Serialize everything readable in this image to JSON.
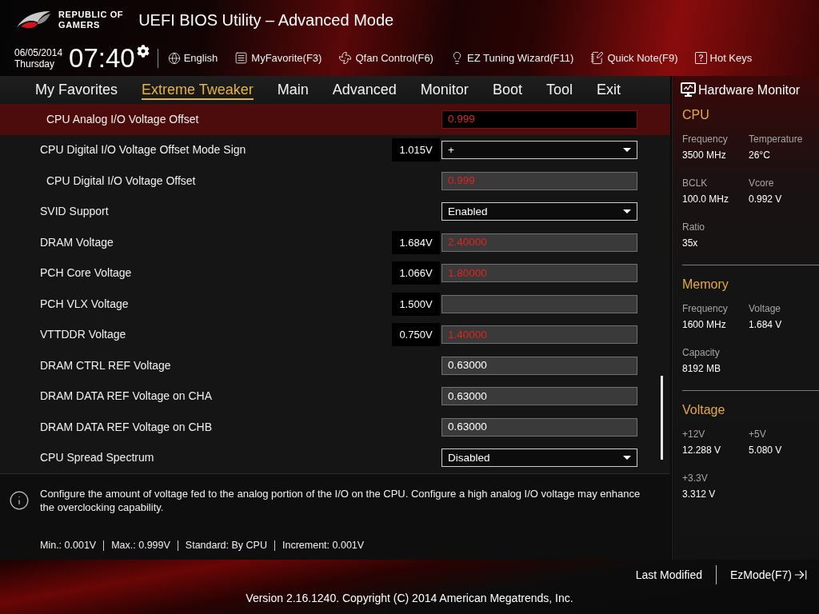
{
  "header": {
    "brand": [
      "REPUBLIC OF",
      "GAMERS"
    ],
    "title": "UEFI BIOS Utility – Advanced Mode"
  },
  "toolbar": {
    "date": "06/05/2014",
    "weekday": "Thursday",
    "time": "07:40",
    "items": [
      {
        "kind": "language",
        "label": "English"
      },
      {
        "kind": "favorite",
        "label": "MyFavorite(F3)"
      },
      {
        "kind": "fan",
        "label": "Qfan Control(F6)"
      },
      {
        "kind": "wizard",
        "label": "EZ Tuning Wizard(F11)"
      },
      {
        "kind": "note",
        "label": "Quick Note(F9)"
      },
      {
        "kind": "help",
        "label": "Hot Keys"
      }
    ]
  },
  "tabs": [
    {
      "label": "My Favorites",
      "selected": false
    },
    {
      "label": "Extreme Tweaker",
      "selected": true
    },
    {
      "label": "Main",
      "selected": false
    },
    {
      "label": "Advanced",
      "selected": false
    },
    {
      "label": "Monitor",
      "selected": false
    },
    {
      "label": "Boot",
      "selected": false
    },
    {
      "label": "Tool",
      "selected": false
    },
    {
      "label": "Exit",
      "selected": false
    }
  ],
  "settings": [
    {
      "label": "CPU Analog I/O Voltage Offset",
      "indented": true,
      "selected": true,
      "kind": "input",
      "value": "0.999",
      "warning": true
    },
    {
      "label": "CPU Digital I/O Voltage Offset Mode Sign",
      "indented": false,
      "selected": false,
      "reading": "1.015V",
      "kind": "dropdown",
      "value": "+",
      "warning": false
    },
    {
      "label": "CPU Digital I/O Voltage Offset",
      "indented": true,
      "selected": false,
      "kind": "input",
      "value": "0.999",
      "warning": true
    },
    {
      "label": "SVID Support",
      "indented": false,
      "selected": false,
      "kind": "dropdown",
      "value": "Enabled",
      "warning": false
    },
    {
      "label": "DRAM Voltage",
      "indented": false,
      "selected": false,
      "reading": "1.684V",
      "kind": "input",
      "value": "2.40000",
      "warning": true
    },
    {
      "label": "PCH Core Voltage",
      "indented": false,
      "selected": false,
      "reading": "1.066V",
      "kind": "input",
      "value": "1.80000",
      "warning": true
    },
    {
      "label": "PCH VLX Voltage",
      "indented": false,
      "selected": false,
      "reading": "1.500V",
      "kind": "input"
    },
    {
      "label": "VTTDDR Voltage",
      "indented": false,
      "selected": false,
      "reading": "0.750V",
      "kind": "input",
      "value": "1.40000",
      "warning": true
    },
    {
      "label": "DRAM CTRL REF Voltage",
      "indented": false,
      "selected": false,
      "kind": "input",
      "value": "0.63000",
      "warning": false
    },
    {
      "label": "DRAM DATA REF Voltage on CHA",
      "indented": false,
      "selected": false,
      "kind": "input",
      "value": "0.63000",
      "warning": false
    },
    {
      "label": "DRAM DATA REF Voltage on CHB",
      "indented": false,
      "selected": false,
      "kind": "input",
      "value": "0.63000",
      "warning": false
    },
    {
      "label": "CPU Spread Spectrum",
      "indented": false,
      "selected": false,
      "kind": "dropdown",
      "value": "Disabled",
      "warning": false
    }
  ],
  "help": {
    "text": "Configure the amount of voltage fed to the analog portion of the I/O on the CPU. Configure a high analog I/O voltage may enhance the overclocking capability.",
    "limits": [
      "Min.: 0.001V",
      "Max.: 0.999V",
      "Standard: By CPU",
      "Increment: 0.001V"
    ]
  },
  "hardware_monitor": {
    "title": "Hardware Monitor",
    "sections": [
      {
        "title": "CPU",
        "items": [
          {
            "label": "Frequency",
            "value": "3500 MHz"
          },
          {
            "label": "Temperature",
            "value": "26°C"
          },
          {
            "label": "BCLK",
            "value": "100.0 MHz"
          },
          {
            "label": "Vcore",
            "value": "0.992 V"
          },
          {
            "label": "Ratio",
            "value": "35x"
          }
        ]
      },
      {
        "title": "Memory",
        "items": [
          {
            "label": "Frequency",
            "value": "1600 MHz"
          },
          {
            "label": "Voltage",
            "value": "1.684 V"
          },
          {
            "label": "Capacity",
            "value": "8192 MB"
          }
        ]
      },
      {
        "title": "Voltage",
        "items": [
          {
            "label": "+12V",
            "value": "12.288 V"
          },
          {
            "label": "+5V",
            "value": "5.080 V"
          },
          {
            "label": "+3.3V",
            "value": "3.312 V"
          }
        ]
      }
    ]
  },
  "footer": {
    "buttons": [
      {
        "kind": "plain",
        "label": "Last Modified"
      },
      {
        "kind": "exit",
        "label": "EzMode(F7)"
      }
    ],
    "copyright": "Version 2.16.1240. Copyright (C) 2014 American Megatrends, Inc."
  }
}
